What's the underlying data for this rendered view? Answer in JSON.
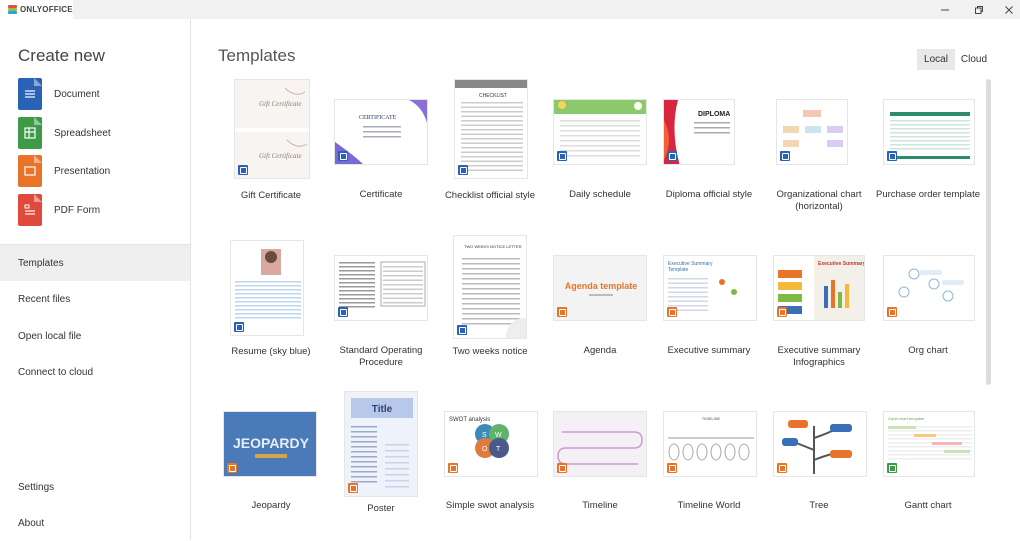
{
  "window": {
    "app_name": "ONLYOFFICE",
    "controls": [
      "minimize",
      "restore",
      "close"
    ]
  },
  "sidebar": {
    "create_title": "Create new",
    "create_items": [
      {
        "label": "Document",
        "icon": "document-icon",
        "color": "#2a62b6"
      },
      {
        "label": "Spreadsheet",
        "icon": "spreadsheet-icon",
        "color": "#3d9a46"
      },
      {
        "label": "Presentation",
        "icon": "presentation-icon",
        "color": "#e8742a"
      },
      {
        "label": "PDF Form",
        "icon": "pdf-form-icon",
        "color": "#e04a3c"
      }
    ],
    "nav_items": [
      "Templates",
      "Recent files",
      "Open local file",
      "Connect to cloud"
    ],
    "active_nav": "Templates",
    "footer_items": [
      "Settings",
      "About"
    ]
  },
  "main": {
    "title": "Templates",
    "source_toggle": {
      "local": "Local",
      "cloud": "Cloud",
      "selected": "Local"
    }
  },
  "templates": [
    {
      "label": "Gift Certificate",
      "type": "document"
    },
    {
      "label": "Certificate",
      "type": "document"
    },
    {
      "label": "Checklist official style",
      "type": "document"
    },
    {
      "label": "Daily schedule",
      "type": "document"
    },
    {
      "label": "Diploma official style",
      "type": "document"
    },
    {
      "label": "Organizational chart (horizontal)",
      "type": "document"
    },
    {
      "label": "Purchase order template",
      "type": "document"
    },
    {
      "label": "Resume (sky blue)",
      "type": "document"
    },
    {
      "label": "Standard Operating Procedure",
      "type": "document"
    },
    {
      "label": "Two weeks notice",
      "type": "document"
    },
    {
      "label": "Agenda",
      "type": "presentation",
      "thumb_text": "Agenda template"
    },
    {
      "label": "Executive summary",
      "type": "presentation",
      "thumb_text": "Executive Summary Template"
    },
    {
      "label": "Executive summary Infographics",
      "type": "presentation",
      "thumb_text": "Executive Summary Template"
    },
    {
      "label": "Org chart",
      "type": "presentation"
    },
    {
      "label": "Jeopardy",
      "type": "presentation",
      "thumb_text": "JEOPARDY"
    },
    {
      "label": "Poster",
      "type": "presentation",
      "thumb_text": "Title"
    },
    {
      "label": "Simple swot analysis",
      "type": "presentation",
      "thumb_text": "SWOT analysis"
    },
    {
      "label": "Timeline",
      "type": "presentation"
    },
    {
      "label": "Timeline World",
      "type": "presentation"
    },
    {
      "label": "Tree",
      "type": "presentation"
    },
    {
      "label": "Gantt chart",
      "type": "spreadsheet"
    }
  ],
  "badge_colors": {
    "document": "#2a62b6",
    "presentation": "#e8742a",
    "spreadsheet": "#3d9a46"
  }
}
